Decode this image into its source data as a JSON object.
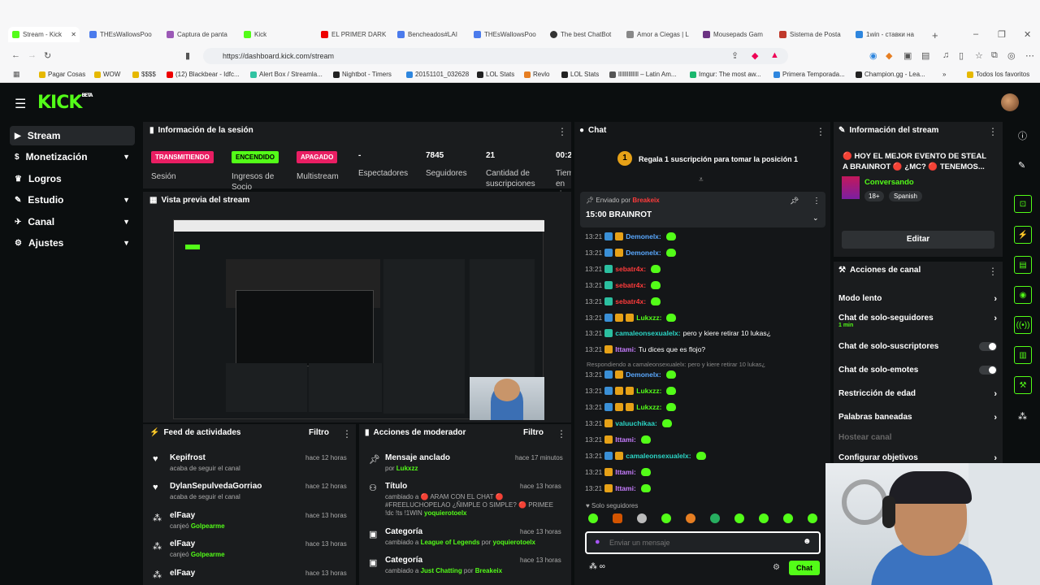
{
  "browser": {
    "tabs": [
      "Stream - Kick",
      "THEsWallowsPoo",
      "Captura de panta",
      "Kick",
      "EL PRIMER DARK",
      "Bencheados#LAI",
      "THEsWallowsPoo",
      "The best ChatBot",
      "Amor a Ciegas | L",
      "Mousepads Gam",
      "Sistema de Posta",
      "1win - ставки на"
    ],
    "url": "https://dashboard.kick.com/stream",
    "bookmarks": [
      "Pagar Cosas",
      "WOW",
      "$$$$",
      "(12) Blackbear - Idfc...",
      "Alert Box / Streamla...",
      "Nightbot - Timers",
      "20151101_032628",
      "LOL Stats",
      "Revlo",
      "LOL Stats",
      "llllllllllllll – Latin Am...",
      "Imgur: The most aw...",
      "Primera Temporada...",
      "Champion.gg - Lea...",
      "Todos los favoritos"
    ]
  },
  "app": {
    "logo": "KICK",
    "logo_sup": "BETA"
  },
  "sidebar": {
    "items": [
      "Stream",
      "Monetización",
      "Logros",
      "Estudio",
      "Canal",
      "Ajustes"
    ]
  },
  "session": {
    "title": "Información de la sesión",
    "stats": [
      {
        "badge": "TRANSMITIENDO",
        "label": "Sesión"
      },
      {
        "badge": "ENCENDIDO",
        "label": "Ingresos de Socio"
      },
      {
        "badge": "APAGADO",
        "label": "Multistream"
      },
      {
        "value": "-",
        "label": "Espectadores"
      },
      {
        "value": "7845",
        "label": "Seguidores"
      },
      {
        "value": "21",
        "label": "Cantidad de suscripciones"
      },
      {
        "value": "00:2",
        "label": "Tiem en vi"
      }
    ]
  },
  "preview": {
    "title": "Vista previa del stream"
  },
  "feed": {
    "title": "Feed de actividades",
    "filter": "Filtro",
    "items": [
      {
        "name": "Kepifrost",
        "desc": "acaba de seguir el canal",
        "time": "hace 12 horas"
      },
      {
        "name": "DylanSepulvedaGorriao",
        "desc": "acaba de seguir el canal",
        "time": "hace 12 horas"
      },
      {
        "name": "elFaay",
        "desc": "canjeó",
        "extra": "Golpearme",
        "time": "hace 13 horas"
      },
      {
        "name": "elFaay",
        "desc": "canjeó",
        "extra": "Golpearme",
        "time": "hace 13 horas"
      },
      {
        "name": "elFaay",
        "desc": "",
        "time": "hace 13 horas"
      }
    ]
  },
  "mod": {
    "title": "Acciones de moderador",
    "filter": "Filtro",
    "items": [
      {
        "name": "Mensaje anclado",
        "desc": "por",
        "who": "Lukxzz",
        "time": "hace 17 minutos"
      },
      {
        "name": "Título",
        "desc": "cambiado a 🔴 ARAM CON EL CHAT 🔴 #FREELUCHOPELAO ¿ÑIMPLE O SIMPLE? 🔴 PRIMEE !dc !ts !1WIN",
        "who": "yoquierotoelx",
        "time": "hace 13 horas"
      },
      {
        "name": "Categoría",
        "desc": "cambiado a",
        "game": "League of Legends",
        "who": "yoquierotoelx",
        "time": "hace 13 horas"
      },
      {
        "name": "Categoría",
        "desc": "cambiado a",
        "game": "Just Chatting",
        "who": "Breakeix",
        "time": "hace 13 horas"
      }
    ]
  },
  "chat": {
    "title": "Chat",
    "gift": "Regala 1 suscripción para tomar la posición 1",
    "pinned_by": "Enviado por",
    "pinned_user": "Breakeix",
    "pinned_msg": "15:00 BRAINROT",
    "reply": "Respondiendo a camaleonsexualelx: pero y kiere retirar 10 lukas¿",
    "lines": [
      {
        "t": "13:21",
        "u": "Demonelx:",
        "c": "#5aa9ff",
        "m": ""
      },
      {
        "t": "13:21",
        "u": "Demonelx:",
        "c": "#5aa9ff",
        "m": ""
      },
      {
        "t": "13:21",
        "u": "sebatr4x:",
        "c": "#ff3b3b",
        "m": ""
      },
      {
        "t": "13:21",
        "u": "sebatr4x:",
        "c": "#ff3b3b",
        "m": ""
      },
      {
        "t": "13:21",
        "u": "sebatr4x:",
        "c": "#ff3b3b",
        "m": ""
      },
      {
        "t": "13:21",
        "u": "Lukxzz:",
        "c": "#53fc18",
        "m": ""
      },
      {
        "t": "13:21",
        "u": "camaleonsexualelx:",
        "c": "#2bd6c6",
        "m": "pero y kiere retirar 10 lukas¿"
      },
      {
        "t": "13:21",
        "u": "Ittami:",
        "c": "#c77dff",
        "m": "Tu dices que es flojo?"
      },
      {
        "t": "13:21",
        "u": "Demonelx:",
        "c": "#5aa9ff",
        "m": ""
      },
      {
        "t": "13:21",
        "u": "Lukxzz:",
        "c": "#53fc18",
        "m": ""
      },
      {
        "t": "13:21",
        "u": "Lukxzz:",
        "c": "#53fc18",
        "m": ""
      },
      {
        "t": "13:21",
        "u": "valuuchikaa:",
        "c": "#2bd6c6",
        "m": ""
      },
      {
        "t": "13:21",
        "u": "Ittami:",
        "c": "#c77dff",
        "m": ""
      },
      {
        "t": "13:21",
        "u": "camaleonsexualelx:",
        "c": "#2bd6c6",
        "m": ""
      },
      {
        "t": "13:21",
        "u": "Ittami:",
        "c": "#c77dff",
        "m": ""
      },
      {
        "t": "13:21",
        "u": "Ittami:",
        "c": "#c77dff",
        "m": ""
      }
    ],
    "followers_only": "Solo seguidores",
    "placeholder": "Enviar un mensaje",
    "send": "Chat"
  },
  "info": {
    "title": "Información del stream",
    "stream_title": "🔴 HOY EL MEJOR EVENTO DE STEAL A BRAINROT 🔴 ¿MC? 🔴 TENEMOS...",
    "category": "Conversando",
    "tags": [
      "18+",
      "Spanish"
    ],
    "edit": "Editar"
  },
  "actions": {
    "title": "Acciones de canal",
    "items": [
      "Modo lento",
      "Chat de solo-seguidores",
      "Chat de solo-suscriptores",
      "Chat de solo-emotes",
      "Restricción de edad",
      "Palabras baneadas",
      "Hostear canal",
      "Configurar objetivos"
    ],
    "followers_sub": "1 min"
  },
  "colors": {
    "accent": "#53fc18",
    "live": "#e91e63",
    "off": "#e91e63"
  }
}
